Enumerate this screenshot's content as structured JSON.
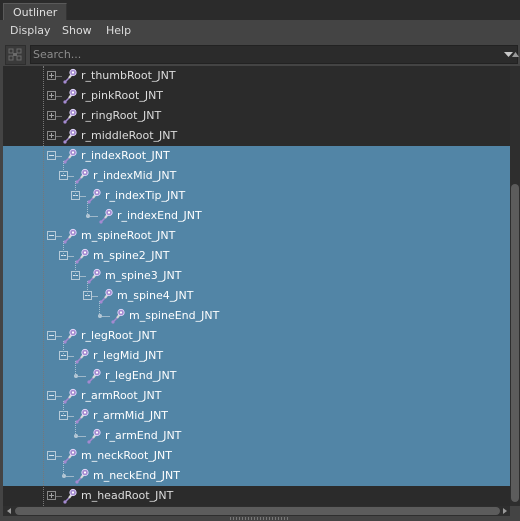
{
  "window": {
    "tab_label": "Outliner"
  },
  "menubar": {
    "items": [
      "Display",
      "Show",
      "Help"
    ]
  },
  "search": {
    "placeholder": "Search..."
  },
  "tree": {
    "nodes": [
      {
        "label": "r_thumbRoot_JNT",
        "depth": 0,
        "expander": "plus",
        "selected": false
      },
      {
        "label": "r_pinkRoot_JNT",
        "depth": 0,
        "expander": "plus",
        "selected": false
      },
      {
        "label": "r_ringRoot_JNT",
        "depth": 0,
        "expander": "plus",
        "selected": false
      },
      {
        "label": "r_middleRoot_JNT",
        "depth": 0,
        "expander": "plus",
        "selected": false
      },
      {
        "label": "r_indexRoot_JNT",
        "depth": 0,
        "expander": "minus",
        "selected": true
      },
      {
        "label": "r_indexMid_JNT",
        "depth": 1,
        "expander": "minus",
        "selected": true
      },
      {
        "label": "r_indexTip_JNT",
        "depth": 2,
        "expander": "minus",
        "selected": true
      },
      {
        "label": "r_indexEnd_JNT",
        "depth": 3,
        "expander": "leaf",
        "selected": true
      },
      {
        "label": "m_spineRoot_JNT",
        "depth": 0,
        "expander": "minus",
        "selected": true
      },
      {
        "label": "m_spine2_JNT",
        "depth": 1,
        "expander": "minus",
        "selected": true
      },
      {
        "label": "m_spine3_JNT",
        "depth": 2,
        "expander": "minus",
        "selected": true
      },
      {
        "label": "m_spine4_JNT",
        "depth": 3,
        "expander": "minus",
        "selected": true
      },
      {
        "label": "m_spineEnd_JNT",
        "depth": 4,
        "expander": "leaf",
        "selected": true
      },
      {
        "label": "r_legRoot_JNT",
        "depth": 0,
        "expander": "minus",
        "selected": true
      },
      {
        "label": "r_legMid_JNT",
        "depth": 1,
        "expander": "minus",
        "selected": true
      },
      {
        "label": "r_legEnd_JNT",
        "depth": 2,
        "expander": "leaf",
        "selected": true
      },
      {
        "label": "r_armRoot_JNT",
        "depth": 0,
        "expander": "minus",
        "selected": true
      },
      {
        "label": "r_armMid_JNT",
        "depth": 1,
        "expander": "minus",
        "selected": true
      },
      {
        "label": "r_armEnd_JNT",
        "depth": 2,
        "expander": "leaf",
        "selected": true
      },
      {
        "label": "m_neckRoot_JNT",
        "depth": 0,
        "expander": "minus",
        "selected": true
      },
      {
        "label": "m_neckEnd_JNT",
        "depth": 1,
        "expander": "leaf",
        "selected": true
      },
      {
        "label": "m_headRoot_JNT",
        "depth": 0,
        "expander": "plus",
        "selected": false
      }
    ]
  },
  "icons": {
    "node_icon": "joint-icon",
    "filter": "filter-toggle-icon",
    "search_dropdown": "chevron-down-icon"
  },
  "colors": {
    "selection": "#5285a6",
    "tree_background": "#2b2b2b",
    "panel_background": "#444444",
    "joint_icon": "#a48ad0"
  }
}
